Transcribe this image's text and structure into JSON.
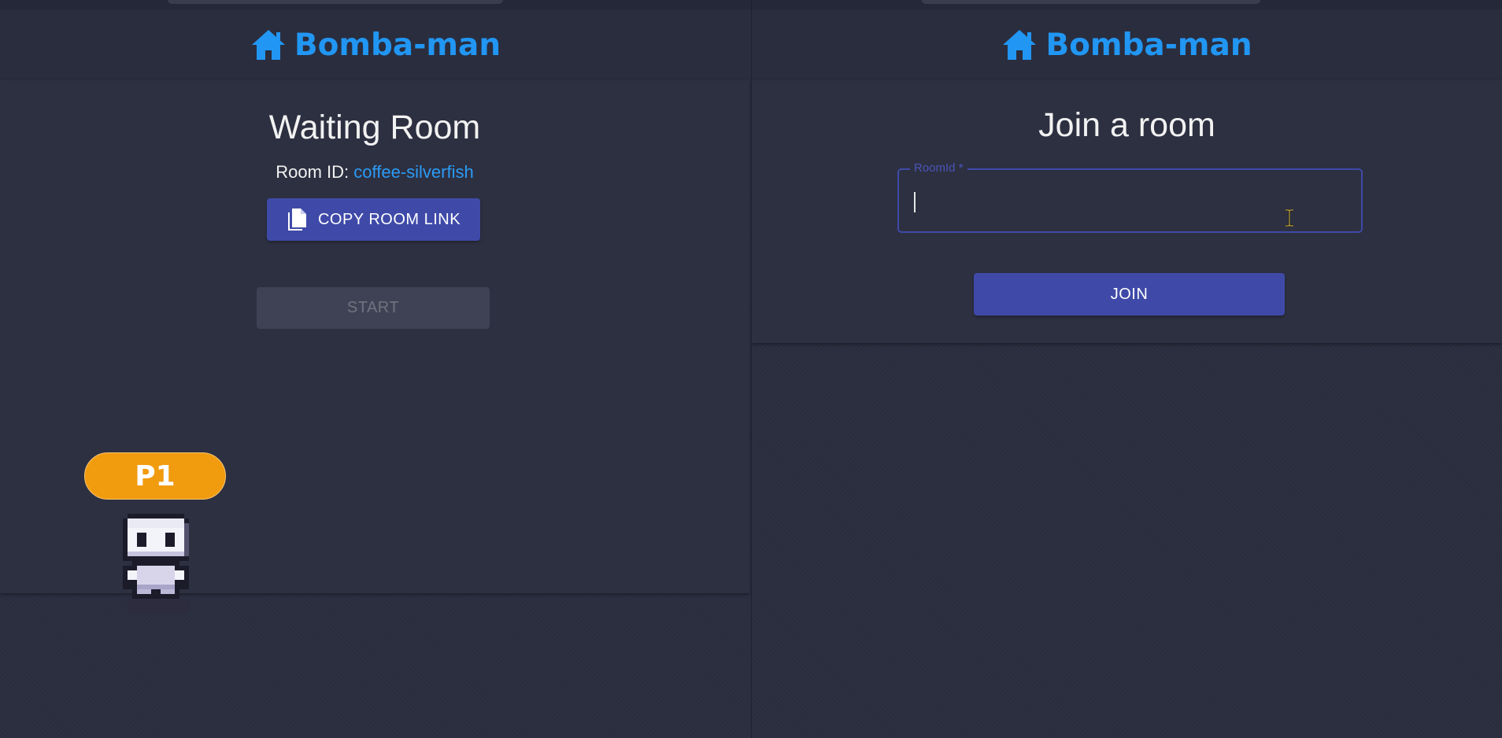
{
  "left_pane": {
    "brand": {
      "icon": "home-icon",
      "title": "Bomba-man"
    },
    "waiting_room": {
      "title": "Waiting Room",
      "room_id_label": "Room ID:",
      "room_id_value": "coffee-silverfish",
      "copy_button": {
        "icon": "copy-icon",
        "label": "COPY ROOM LINK"
      },
      "start_button": {
        "label": "START",
        "disabled": true
      },
      "players": [
        {
          "badge": "P1",
          "badge_color": "#f19b0f",
          "avatar": "pixel-character-sprite"
        }
      ]
    }
  },
  "right_pane": {
    "brand": {
      "icon": "home-icon",
      "title": "Bomba-man"
    },
    "join_room": {
      "title": "Join a room",
      "room_id_field": {
        "label": "RoomId *",
        "value": ""
      },
      "join_button": {
        "label": "JOIN"
      }
    }
  },
  "colors": {
    "background": "#2b2e3f",
    "card": "#2d3041",
    "brand": "#2196f3",
    "primary_button": "#3f4aa8",
    "disabled_button": "#3f4254",
    "link_text": "#2b9bf5",
    "player_badge": "#f19b0f"
  }
}
